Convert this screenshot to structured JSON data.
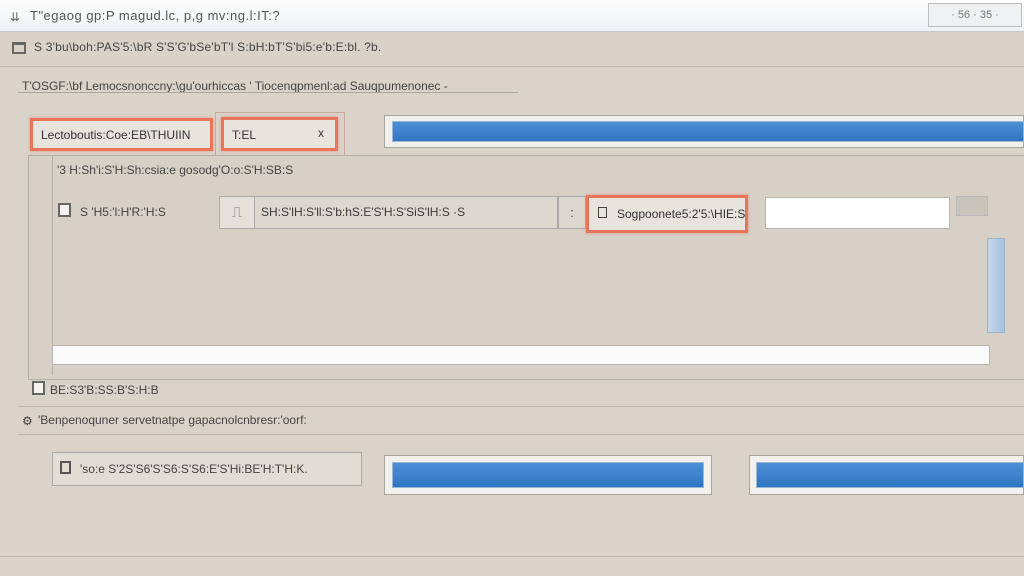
{
  "window": {
    "title": "T\"egaog gp:P magud.lc, p,g mv:ng.l:IT:?",
    "title_right": "· 56 · 35 ·"
  },
  "toolbar": {
    "text": "S 3'bu\\boh:PAS'5:\\bR S'S'G'bSe'bT'l S:bH:bT'S'bi5:e'b:E:bl. ?b."
  },
  "group": {
    "label": "T'OSGF:\\bf Lemocsnonccny:\\gu'ourhiccas ' Tiocenqpmenl:ad Sauqpumenonec -"
  },
  "buttons": {
    "first_label": "Lectoboutis:Coe:EB\\THUIIN",
    "second_label": "T:EL",
    "second_x": "x",
    "third_label": "Sogpoonete5:2'5:\\HIE:S"
  },
  "panel": {
    "title": "'3 H:Sh'i:S'H:Sh:csia:e gosodg'O:o:S'H:SB:S",
    "checkbox1_label": "S 'H5:'l:H'R:'H:S",
    "combo_value": "SH:S'lH:S'll:S'b:hS:E'S'H:S'SiS'lH:S ·S",
    "combo_gap": ":",
    "combo_icon": "⎍"
  },
  "section": {
    "checkbox2_label": "BE:S3'B:SS:B'S:H:B",
    "label": "'Benpenoquner servetnatpe gapacnolcnbresr:'oorf:"
  },
  "bottom": {
    "field_text": "'so:e S'2S'S6'S'S6:S'S6:E'S'Hi:BE'H:T'H:K."
  }
}
